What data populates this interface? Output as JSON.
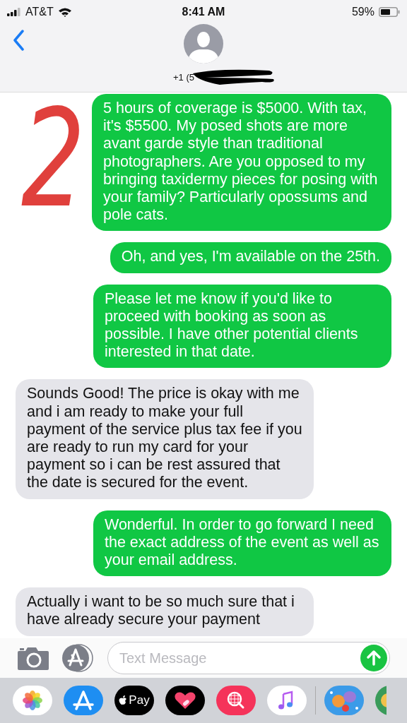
{
  "status_bar": {
    "carrier": "AT&T",
    "time": "8:41 AM",
    "battery": "59%"
  },
  "header": {
    "contact": "+1 (5"
  },
  "annotation": "2",
  "messages": [
    {
      "kind": "sent",
      "text": "5 hours of coverage is $5000. With tax, it's $5500. My posed shots are more avant garde style than traditional photographers. Are you opposed to my bringing taxidermy pieces for posing with your family? Particularly opossums and pole cats."
    },
    {
      "kind": "sent",
      "text": "Oh, and yes, I'm available on the 25th."
    },
    {
      "kind": "sent",
      "text": "Please let me know if you'd like to proceed with booking as soon as possible. I have other potential clients interested in that date."
    },
    {
      "kind": "received",
      "text": "Sounds Good! The price is okay with me and i am ready to make your full payment of the service plus tax fee if you are ready to run my card for your payment so i can be rest assured that the date is secured for the event."
    },
    {
      "kind": "sent",
      "text": "Wonderful. In order to go forward I need the exact address of the event as well as your email address."
    },
    {
      "kind": "received",
      "text": "Actually i want to be so much sure that i have already secure your payment"
    }
  ],
  "composer": {
    "placeholder": "Text Message"
  },
  "app_drawer": [
    {
      "kind": "photos"
    },
    {
      "kind": "appstore"
    },
    {
      "kind": "pay",
      "label": "Pay"
    },
    {
      "kind": "heart"
    },
    {
      "kind": "search"
    },
    {
      "kind": "music"
    },
    {
      "kind": "sticker"
    },
    {
      "kind": "partial"
    }
  ]
}
